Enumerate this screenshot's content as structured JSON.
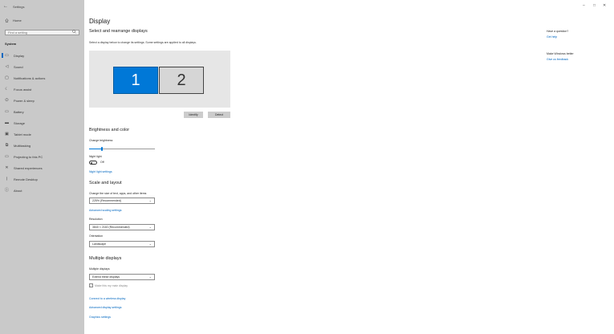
{
  "window": {
    "back_glyph": "←",
    "app_name": "Settings",
    "minimize_glyph": "–",
    "maximize_glyph": "□",
    "close_glyph": "✕"
  },
  "sidebar": {
    "home_icon": "home-icon",
    "home_label": "Home",
    "search_placeholder": "Find a setting",
    "search_icon": "search-icon",
    "section": "System",
    "items": [
      {
        "label": "Display",
        "icon": "monitor-icon",
        "glyph": "▭",
        "selected": true
      },
      {
        "label": "Sound",
        "icon": "speaker-icon",
        "glyph": "◁"
      },
      {
        "label": "Notifications & actions",
        "icon": "notification-icon",
        "glyph": "▢"
      },
      {
        "label": "Focus assist",
        "icon": "moon-icon",
        "glyph": "☾"
      },
      {
        "label": "Power & sleep",
        "icon": "power-icon",
        "glyph": "⏻"
      },
      {
        "label": "Battery",
        "icon": "battery-icon",
        "glyph": "▭"
      },
      {
        "label": "Storage",
        "icon": "storage-icon",
        "glyph": "▬"
      },
      {
        "label": "Tablet mode",
        "icon": "tablet-icon",
        "glyph": "▣"
      },
      {
        "label": "Multitasking",
        "icon": "multitasking-icon",
        "glyph": "⧉"
      },
      {
        "label": "Projecting to this PC",
        "icon": "projecting-icon",
        "glyph": "▭"
      },
      {
        "label": "Shared experiences",
        "icon": "shared-icon",
        "glyph": "✕"
      },
      {
        "label": "Remote Desktop",
        "icon": "remote-icon",
        "glyph": "⟩"
      },
      {
        "label": "About",
        "icon": "info-icon",
        "glyph": "ⓘ"
      }
    ]
  },
  "main": {
    "title": "Display",
    "arrange": {
      "heading": "Select and rearrange displays",
      "description": "Select a display below to change its settings. Some settings are applied to all displays.",
      "monitor1": "1",
      "monitor2": "2",
      "identify": "Identify",
      "detect": "Detect"
    },
    "brightness": {
      "heading": "Brightness and color",
      "change_label": "Change brightness",
      "level_fraction": 0.2,
      "night_light_label": "Night light",
      "night_light_state": "Off",
      "night_light_settings": "Night light settings"
    },
    "scale": {
      "heading": "Scale and layout",
      "size_label": "Change the size of text, apps, and other items",
      "size_value": "225% (Recommended)",
      "advanced_link": "Advanced scaling settings",
      "resolution_label": "Resolution",
      "resolution_value": "3840 × 2160 (Recommended)",
      "orientation_label": "Orientation",
      "orientation_value": "Landscape"
    },
    "multiple": {
      "heading": "Multiple displays",
      "label": "Multiple displays",
      "value": "Extend these displays",
      "main_display_label": "Make this my main display",
      "links": [
        "Connect to a wireless display",
        "Advanced display settings",
        "Graphics settings"
      ]
    }
  },
  "right": {
    "q_heading": "Have a question?",
    "q_link": "Get help",
    "w_heading": "Make Windows better",
    "w_link": "Give us feedback"
  }
}
